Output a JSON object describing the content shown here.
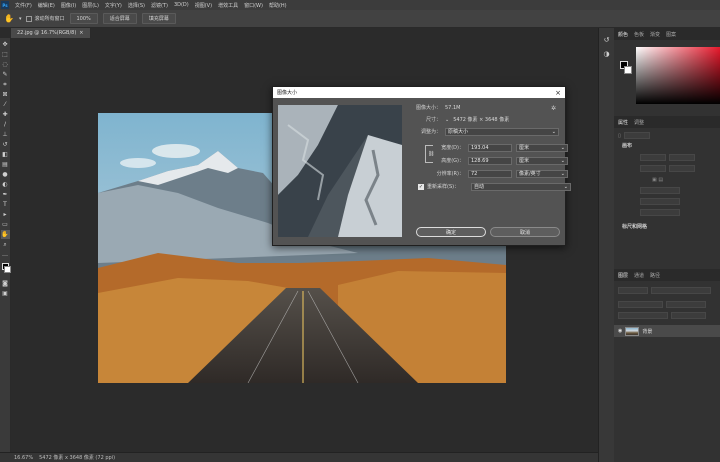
{
  "app": {
    "logo": "Ps",
    "menu": [
      "文件(F)",
      "编辑(E)",
      "图像(I)",
      "图层(L)",
      "文字(Y)",
      "选择(S)",
      "滤镜(T)",
      "3D(D)",
      "视图(V)",
      "增效工具",
      "窗口(W)",
      "帮助(H)"
    ]
  },
  "options_bar": {
    "scroll_all_label": "滚动所有窗口",
    "zoom_value": "100%",
    "fit_screen_label": "适合屏幕",
    "fill_screen_label": "填充屏幕"
  },
  "document": {
    "tab_label": "22.jpg @ 16.7%(RGB/8)",
    "status_zoom": "16.67%",
    "status_info": "5472 像素 x 3648 像素 (72 ppi)"
  },
  "color_panel": {
    "tabs": [
      "颜色",
      "色板",
      "渐变",
      "图案"
    ]
  },
  "properties_panel": {
    "tabs": [
      "属性",
      "调整"
    ],
    "section_title": "画布",
    "section_guides": "标尺和网格"
  },
  "layers_panel": {
    "tabs": [
      "图层",
      "通道",
      "路径"
    ],
    "layer_name": "背景"
  },
  "dialog": {
    "title": "图像大小",
    "image_size_label": "图像大小：",
    "image_size_value": "57.1M",
    "dimensions_label": "尺寸：",
    "dimensions_value": "5472 像素 × 3648 像素",
    "fit_to_label": "调整为：",
    "fit_to_value": "原稿大小",
    "width_label": "宽度(D)：",
    "width_value": "193.04",
    "width_unit": "厘米",
    "height_label": "高度(G)：",
    "height_value": "128.69",
    "height_unit": "厘米",
    "resolution_label": "分辨率(R)：",
    "resolution_value": "72",
    "resolution_unit": "像素/英寸",
    "resample_label": "重新采样(S)：",
    "resample_value": "自动",
    "ok_label": "确定",
    "cancel_label": "取消"
  }
}
